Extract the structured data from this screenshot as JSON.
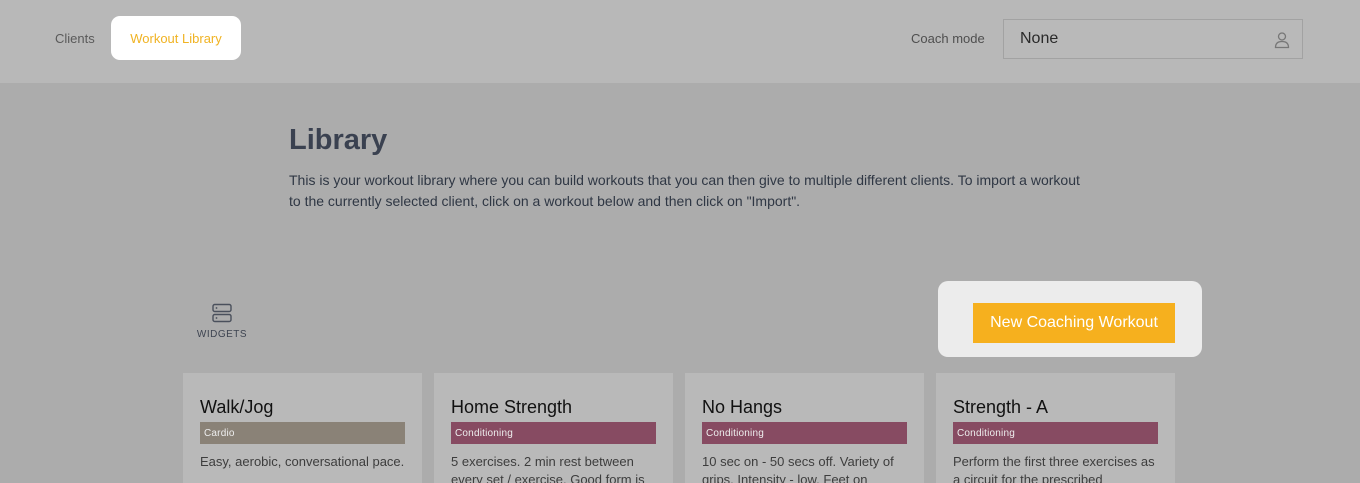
{
  "nav": {
    "clients_label": "Clients",
    "library_label": "Workout Library",
    "accent_color": "#f0b323"
  },
  "coach": {
    "label": "Coach mode",
    "selected": "None",
    "icon": "user-icon"
  },
  "library": {
    "title": "Library",
    "description": "This is your workout library where you can build workouts that you can then give to multiple different clients. To import a workout to the currently selected client, click on a workout below and then click on \"Import\"."
  },
  "widgets": {
    "label": "WIDGETS",
    "icon": "server-icon"
  },
  "new_workout": {
    "label": "New Coaching Workout",
    "color": "#f6b01e"
  },
  "cards": [
    {
      "title": "Walk/Jog",
      "tag": "Cardio",
      "tag_color": "#8a8277",
      "desc": "Easy, aerobic, conversational pace."
    },
    {
      "title": "Home Strength",
      "tag": "Conditioning",
      "tag_color": "#874b62",
      "desc": "5 exercises. 2 min rest between every set / exercise. Good form is"
    },
    {
      "title": "No Hangs",
      "tag": "Conditioning",
      "tag_color": "#874b62",
      "desc": "10 sec on - 50 secs off. Variety of grips. Intensity - low. Feet on"
    },
    {
      "title": "Strength - A",
      "tag": "Conditioning",
      "tag_color": "#874b62",
      "desc": "Perform the first three exercises as a circuit for the prescribed"
    }
  ]
}
